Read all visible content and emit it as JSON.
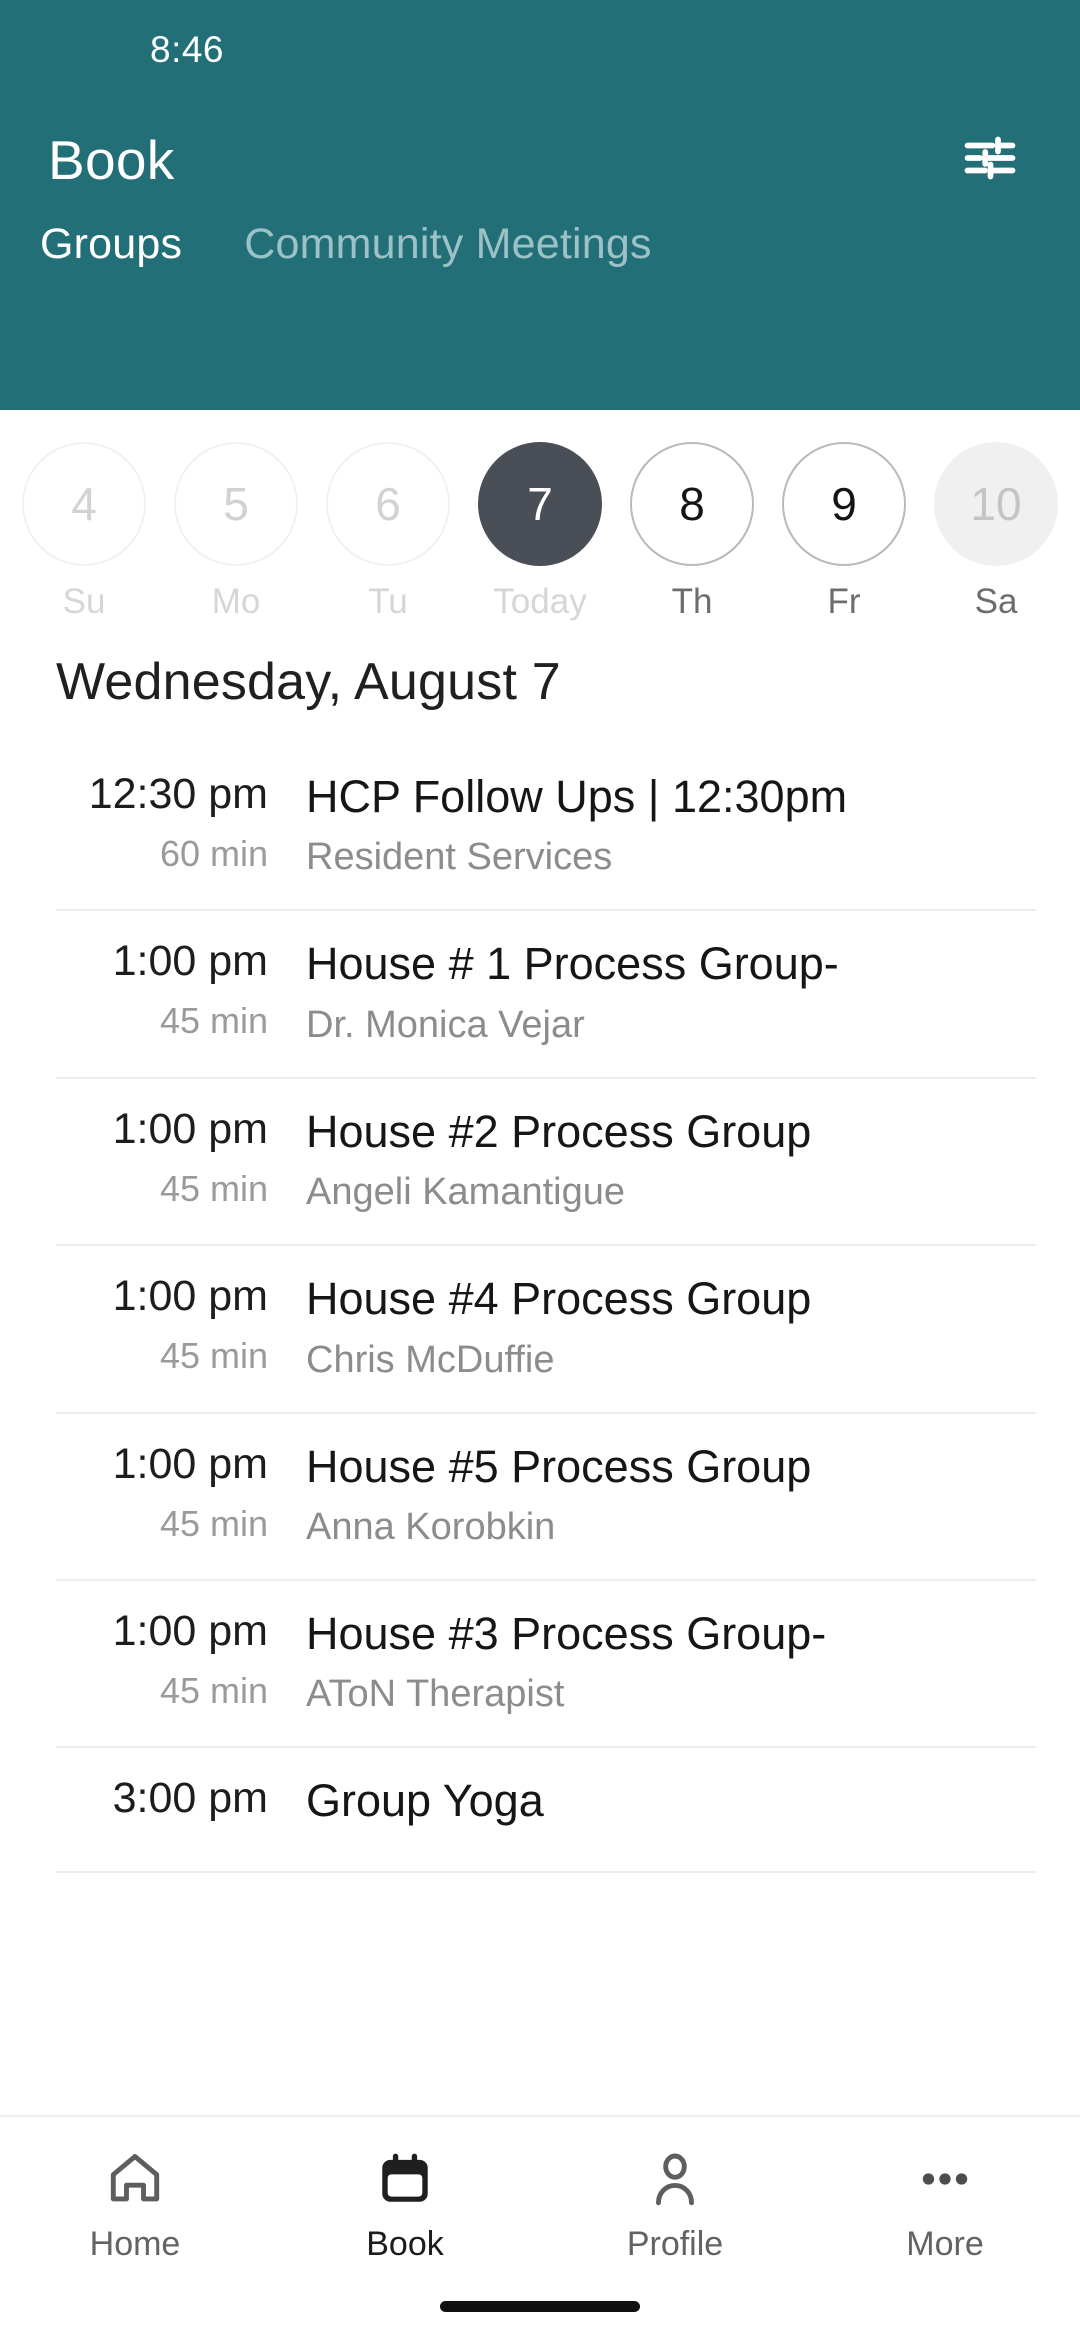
{
  "status_bar": {
    "time": "8:46"
  },
  "header": {
    "title": "Book",
    "background_color": "#226f78",
    "filter_icon": "tune-sliders-icon",
    "tabs": [
      {
        "label": "Groups",
        "active": true
      },
      {
        "label": "Community Meetings",
        "active": false
      }
    ]
  },
  "date_strip": {
    "days": [
      {
        "num": "4",
        "weekday": "Su",
        "state": "past"
      },
      {
        "num": "5",
        "weekday": "Mo",
        "state": "past"
      },
      {
        "num": "6",
        "weekday": "Tu",
        "state": "past"
      },
      {
        "num": "7",
        "weekday": "Today",
        "state": "today"
      },
      {
        "num": "8",
        "weekday": "Th",
        "state": "future"
      },
      {
        "num": "9",
        "weekday": "Fr",
        "state": "future"
      },
      {
        "num": "10",
        "weekday": "Sa",
        "state": "disabled"
      }
    ]
  },
  "schedule": {
    "date_heading": "Wednesday, August 7",
    "events": [
      {
        "time": "12:30 pm",
        "duration": "60 min",
        "title": "HCP Follow Ups | 12:30pm",
        "subtitle": "Resident Services"
      },
      {
        "time": "1:00 pm",
        "duration": "45 min",
        "title": "House # 1 Process Group-",
        "subtitle": "Dr. Monica Vejar"
      },
      {
        "time": "1:00 pm",
        "duration": "45 min",
        "title": "House #2 Process Group",
        "subtitle": "Angeli Kamantigue"
      },
      {
        "time": "1:00 pm",
        "duration": "45 min",
        "title": "House #4 Process Group",
        "subtitle": "Chris McDuffie"
      },
      {
        "time": "1:00 pm",
        "duration": "45 min",
        "title": "House #5 Process Group",
        "subtitle": "Anna Korobkin"
      },
      {
        "time": "1:00 pm",
        "duration": "45 min",
        "title": "House #3 Process Group-",
        "subtitle": "AToN Therapist"
      },
      {
        "time": "3:00 pm",
        "duration": "",
        "title": "Group Yoga",
        "subtitle": ""
      }
    ]
  },
  "bottom_nav": {
    "items": [
      {
        "label": "Home",
        "icon": "home-icon",
        "active": false
      },
      {
        "label": "Book",
        "icon": "calendar-icon",
        "active": true
      },
      {
        "label": "Profile",
        "icon": "person-icon",
        "active": false
      },
      {
        "label": "More",
        "icon": "ellipsis-icon",
        "active": false
      }
    ]
  }
}
